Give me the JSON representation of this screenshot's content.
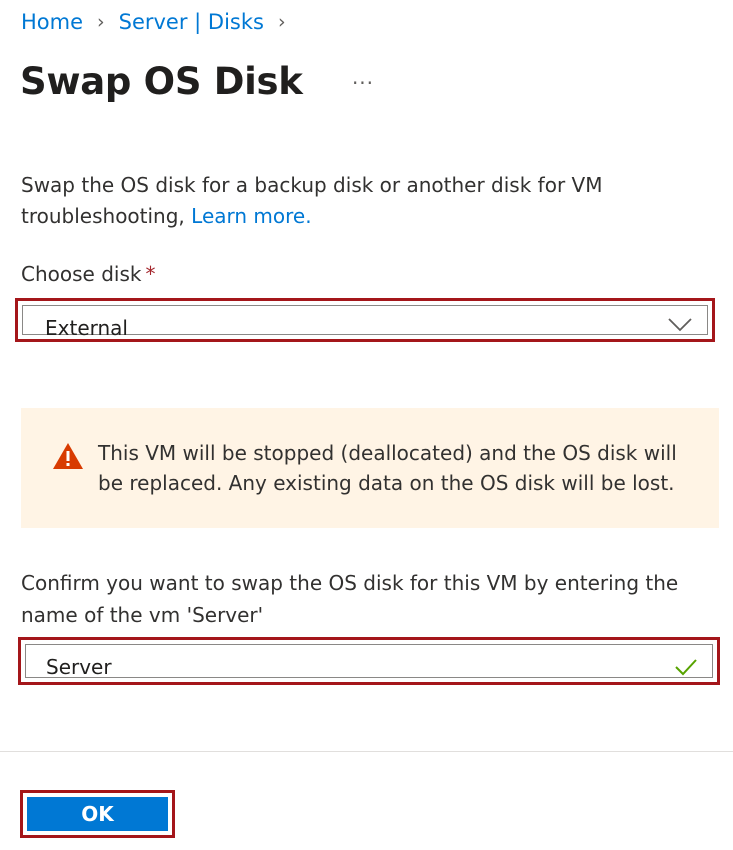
{
  "breadcrumb": {
    "home": "Home",
    "server_disks": "Server | Disks"
  },
  "page": {
    "title": "Swap OS Disk",
    "more_icon": "more-ellipsis-icon"
  },
  "description": {
    "text": "Swap the OS disk for a backup disk or another disk for VM troubleshooting,",
    "learn_more": "Learn more."
  },
  "choose_disk": {
    "label": "Choose disk",
    "required_marker": "*",
    "selected": "External",
    "icon": "chevron-down-icon"
  },
  "warning": {
    "icon": "warning-triangle-icon",
    "text": "This VM will be stopped (deallocated) and the OS disk will be replaced. Any existing data on the OS disk will be lost.",
    "background": "#fff4e5",
    "icon_color": "#d83b01"
  },
  "confirm": {
    "label": "Confirm you want to swap the OS disk for this VM by entering the name of the vm 'Server'",
    "value": "Server",
    "valid_icon": "checkmark-icon",
    "valid_color": "#57a300"
  },
  "actions": {
    "ok_label": "OK"
  },
  "colors": {
    "accent": "#0078d4",
    "highlight_border": "#a4161a"
  }
}
